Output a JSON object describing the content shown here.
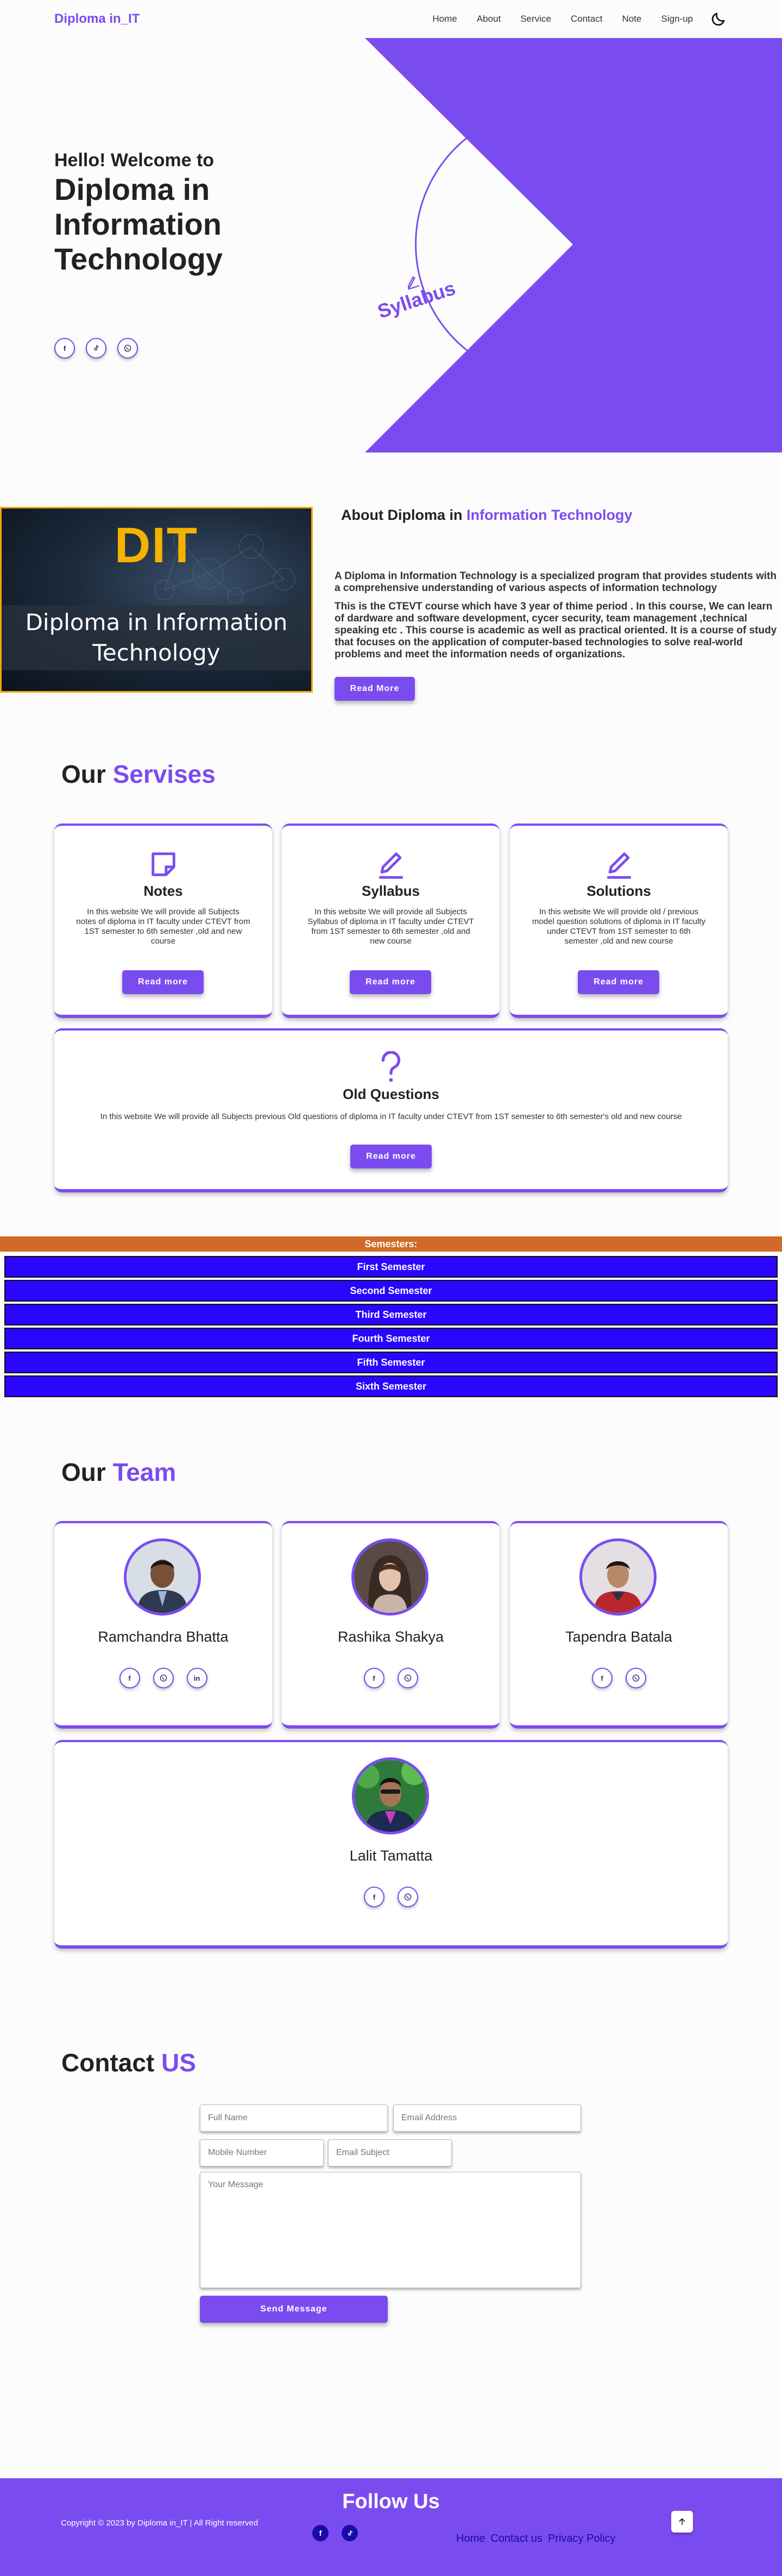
{
  "nav": {
    "logo": "Diploma in_IT",
    "links": [
      "Home",
      "About",
      "Service",
      "Contact",
      "Note",
      "Sign-up"
    ]
  },
  "hero": {
    "hello": "Hello! Welcome to",
    "title": "Diploma in Information Technology",
    "syllabus_label": "Syllabus",
    "social_icons": [
      "facebook-icon",
      "tiktok-icon",
      "whatsapp-icon"
    ]
  },
  "about": {
    "image_title": "DIT",
    "image_caption": "Diploma in Information Technology",
    "heading_prefix": "About Diploma in",
    "heading_accent": "Information Technology",
    "p1": "A Diploma in Information Technology is a specialized program that provides students with a comprehensive understanding of various aspects of information technology",
    "p2": "This is the CTEVT course which have 3 year of thime period . In this course, We can learn of dardware and software development, cycer security, team management ,technical speaking etc . This course is academic as well as practical oriented. It is a course of study that focuses on the application of computer-based technologies to solve real-world problems and meet the information needs of organizations.",
    "button": "Read More"
  },
  "services": {
    "title_prefix": "Our",
    "title_accent": "Servises",
    "cards": [
      {
        "title": "Notes",
        "icon": "note-icon",
        "text": "In this website We will provide all Subjects notes of diploma in IT faculty under CTEVT from 1ST semester to 6th semester ,old and new course",
        "button": "Read more"
      },
      {
        "title": "Syllabus",
        "icon": "pencil-icon",
        "text": "In this website We will provide all Subjects Syllabus of diploma in IT faculty under CTEVT from 1ST semester to 6th semester ,old and new course",
        "button": "Read more"
      },
      {
        "title": "Solutions",
        "icon": "pencil-icon",
        "text": "In this website We will provide old / previous model question solutions of diploma in IT faculty under CTEVT from 1ST semester to 6th semester ,old and new course",
        "button": "Read more"
      },
      {
        "title": "Old Questions",
        "icon": "question-icon",
        "text": "In this website We will provide all Subjects previous Old questions of diploma in IT faculty under CTEVT from 1ST semester to 6th semester's old and new course",
        "button": "Read more"
      }
    ]
  },
  "semesters": {
    "heading": "Semesters:",
    "items": [
      "First Semester",
      "Second Semester",
      "Third Semester",
      "Fourth Semester",
      "Fifth Semester",
      "Sixth Semester"
    ]
  },
  "team": {
    "title_prefix": "Our",
    "title_accent": "Team",
    "members": [
      {
        "name": "Ramchandra Bhatta",
        "socials": [
          "facebook-icon",
          "whatsapp-icon",
          "linkedin-icon"
        ]
      },
      {
        "name": "Rashika Shakya",
        "socials": [
          "facebook-icon",
          "whatsapp-icon"
        ]
      },
      {
        "name": "Tapendra Batala",
        "socials": [
          "facebook-icon",
          "whatsapp-icon"
        ]
      },
      {
        "name": "Lalit Tamatta",
        "socials": [
          "facebook-icon",
          "whatsapp-icon"
        ]
      }
    ]
  },
  "contact": {
    "title_prefix": "Contact",
    "title_accent": "US",
    "full_name_placeholder": "Full Name",
    "email_placeholder": "Email Address",
    "mobile_placeholder": "Mobile Number",
    "subject_placeholder": "Email Subject",
    "message_placeholder": "Your Message",
    "button": "Send Message"
  },
  "footer": {
    "title": "Follow Us",
    "copyright": "Copyright © 2023 by Diploma in_IT | All Right reserved",
    "links": [
      "Home",
      "Contact us",
      "Privacy Policy"
    ]
  },
  "colors": {
    "accent": "#7a4cf0",
    "semester_header": "#d16a28",
    "semester_button": "#2a06ff"
  }
}
